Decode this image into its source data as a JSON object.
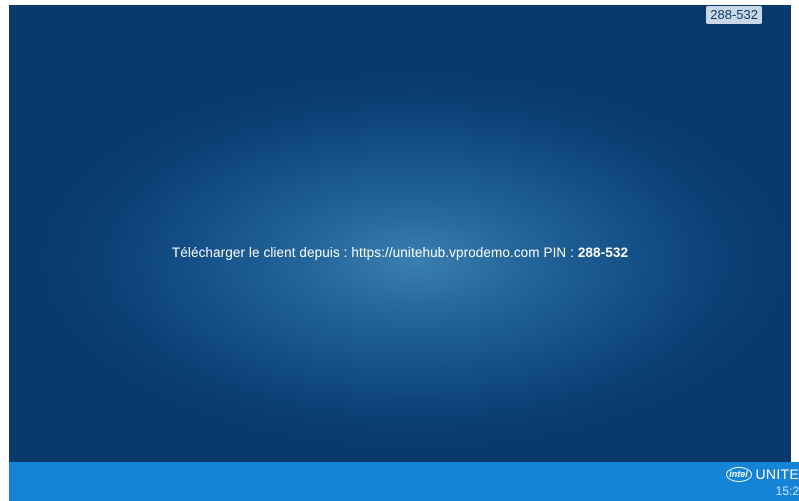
{
  "screen": {
    "pin_badge": "288-532",
    "message_prefix": "Télécharger le client depuis : https://unitehub.vprodemo.com PIN : ",
    "message_pin": "288-532"
  },
  "taskbar": {
    "logo_text": "intel",
    "brand_name": "UNITE",
    "clock": "15:2"
  },
  "colors": {
    "screen_background": "#0a3e73",
    "taskbar_background": "#1684d6",
    "badge_background": "#c9d7e6"
  }
}
